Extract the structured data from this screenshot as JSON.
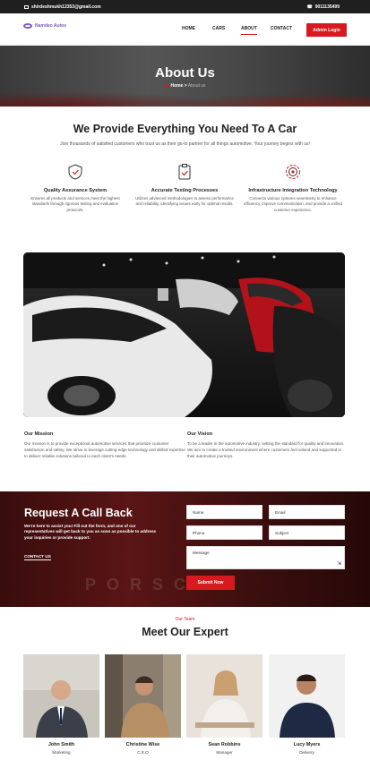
{
  "topbar": {
    "email": "shirdeshmukh12353@gmail.com",
    "phone": "9011135499"
  },
  "nav": {
    "brand": "Namdeo Autos",
    "items": [
      "HOME",
      "CARS",
      "ABOUT",
      "CONTACT"
    ],
    "active": "ABOUT",
    "admin_button": "Admin Login"
  },
  "hero": {
    "title": "About Us",
    "crumb_home": "Home",
    "crumb_sep": ">",
    "crumb_current": "About us"
  },
  "intro": {
    "title": "We Provide Everything You Need To A Car",
    "subtitle": "Join thousands of satisfied customers who trust us as their go-to partner for all things automotive. Your journey begins with us!"
  },
  "features": [
    {
      "icon": "shield-check-icon",
      "title": "Quality Assurance System",
      "text": "Ensures all products and services meet the highest standards through rigorous testing and evaluation protocols."
    },
    {
      "icon": "clipboard-check-icon",
      "title": "Accurate Testing Processes",
      "text": "Utilizes advanced methodologies to assess performance and reliability, identifying issues early for optimal results."
    },
    {
      "icon": "target-gear-icon",
      "title": "Infrastructure Integration Technology",
      "text": "Connects various systems seamlessly to enhance efficiency, improve communication, and provide a unified customer experience."
    }
  ],
  "mission": {
    "title": "Our Mission",
    "text": "Our mission is to provide exceptional automotive services that prioritize customer satisfaction and safety. We strive to leverage cutting-edge technology and skilled expertise to deliver reliable solutions tailored to each client's needs."
  },
  "vision": {
    "title": "Our Vision",
    "text": "To be a leader in the automotive industry, setting the standard for quality and innovation. We aim to create a trusted environment where customers feel valued and supported in their automotive journeys."
  },
  "callback": {
    "title": "Request A Call Back",
    "desc": "We're here to assist you! Fill out the form, and one of our representatives will get back to you as soon as possible to address your inquiries or provide support.",
    "contact_link": "CONTACT US",
    "name_placeholder": "Name",
    "email_placeholder": "Email",
    "phone_placeholder": "Phone",
    "subject_placeholder": "Subject",
    "message_placeholder": "Message",
    "submit": "Submit Now"
  },
  "team": {
    "tag": "Our Team",
    "title": "Meet Our Expert",
    "members": [
      {
        "name": "John Smith",
        "role": "Marketing"
      },
      {
        "name": "Christine Wise",
        "role": "C.E.O"
      },
      {
        "name": "Sean Robbins",
        "role": "Manager"
      },
      {
        "name": "Lucy Myers",
        "role": "Delivery"
      }
    ]
  },
  "colors": {
    "accent": "#d71920",
    "dark": "#1f1f1f",
    "brand": "#7a5bb8"
  }
}
